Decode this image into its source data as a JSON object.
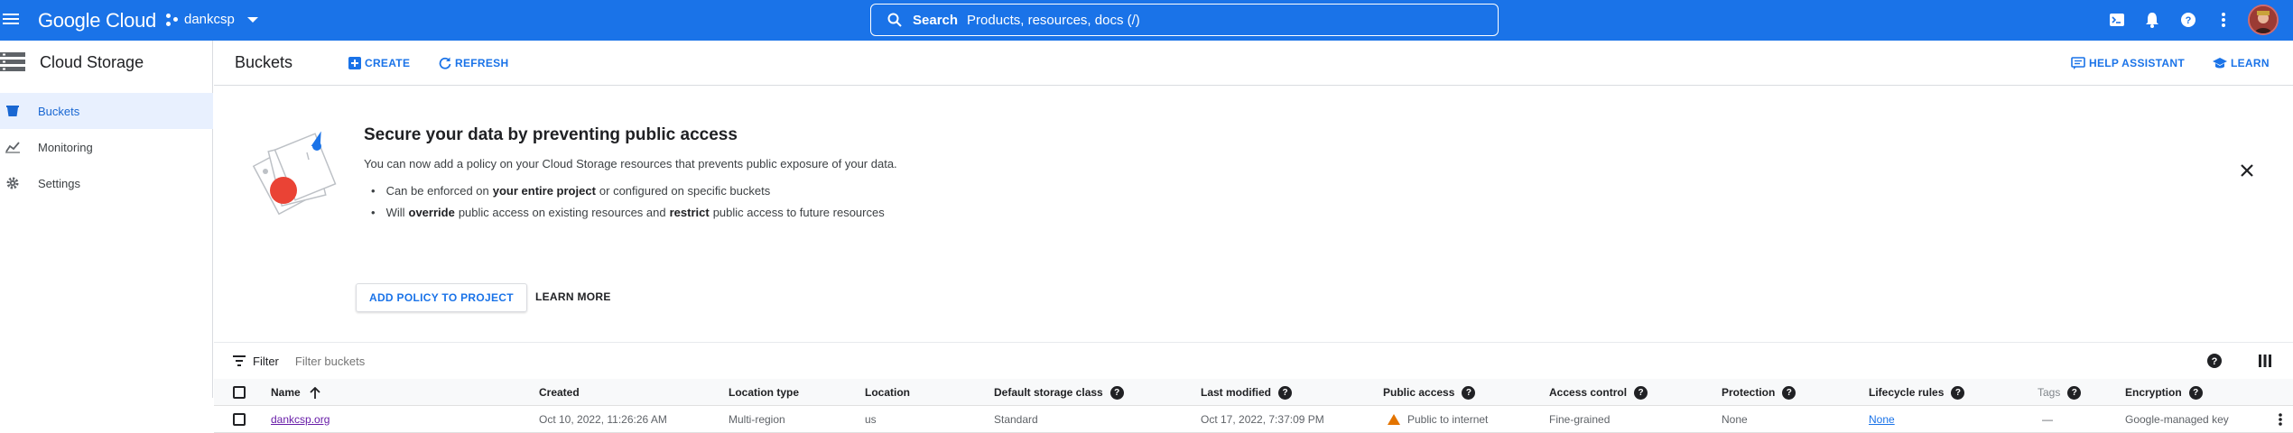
{
  "topbar": {
    "product": "Google Cloud",
    "project": "dankcsp",
    "search_label": "Search",
    "search_placeholder": "Products, resources, docs (/)"
  },
  "sidebar": {
    "title": "Cloud Storage",
    "items": [
      {
        "label": "Buckets",
        "icon": "bucket-icon",
        "active": true
      },
      {
        "label": "Monitoring",
        "icon": "chart-icon",
        "active": false
      },
      {
        "label": "Settings",
        "icon": "gear-icon",
        "active": false
      }
    ]
  },
  "header": {
    "title": "Buckets",
    "create": "CREATE",
    "refresh": "REFRESH",
    "help_assistant": "HELP ASSISTANT",
    "learn": "LEARN"
  },
  "banner": {
    "title": "Secure your data by preventing public access",
    "text": "You can now add a policy on your Cloud Storage resources that prevents public exposure of your data.",
    "bullet1_pre": "Can be enforced on",
    "bullet1_bold": "your entire project",
    "bullet1_post": "or configured on specific buckets",
    "bullet2_pre": "Will",
    "bullet2_bold1": "override",
    "bullet2_mid": "public access on existing resources and",
    "bullet2_bold2": "restrict",
    "bullet2_post": "public access to future resources",
    "add_policy": "ADD POLICY TO PROJECT",
    "learn_more": "LEARN MORE"
  },
  "filter": {
    "label": "Filter",
    "placeholder": "Filter buckets"
  },
  "table": {
    "columns": {
      "name": "Name",
      "created": "Created",
      "location_type": "Location type",
      "location": "Location",
      "storage_class": "Default storage class",
      "last_modified": "Last modified",
      "public_access": "Public access",
      "access_control": "Access control",
      "protection": "Protection",
      "lifecycle": "Lifecycle rules",
      "tags": "Tags",
      "encryption": "Encryption"
    },
    "rows": [
      {
        "name": "dankcsp.org",
        "created": "Oct 10, 2022, 11:26:26 AM",
        "location_type": "Multi-region",
        "location": "us",
        "storage_class": "Standard",
        "last_modified": "Oct 17, 2022, 7:37:09 PM",
        "public_access": "Public to internet",
        "access_control": "Fine-grained",
        "protection": "None",
        "lifecycle": "None",
        "tags": "—",
        "encryption": "Google-managed key"
      }
    ]
  },
  "colors": {
    "topbar": "#1a73e8",
    "accent": "#1a73e8",
    "warning": "#e37400",
    "link_visited": "#681da8"
  }
}
